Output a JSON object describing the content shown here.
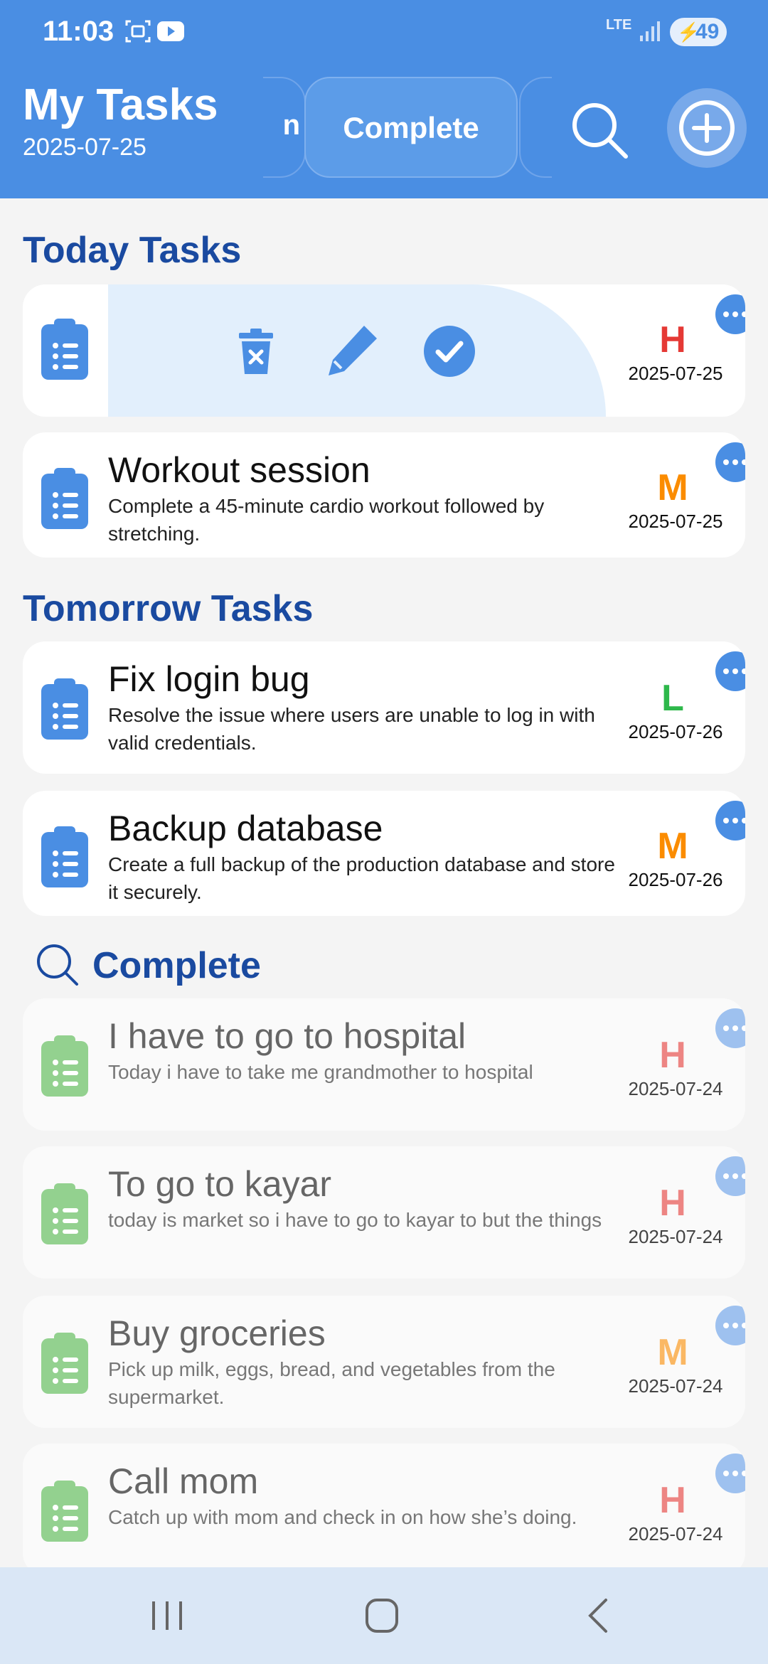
{
  "status_bar": {
    "time": "11:03",
    "network": "LTE",
    "battery": "49"
  },
  "header": {
    "title": "My Tasks",
    "date": "2025-07-25",
    "tabs": {
      "active": "Complete",
      "previous_partial": "n"
    }
  },
  "sections": {
    "today": "Today Tasks",
    "tomorrow": "Tomorrow Tasks",
    "complete": "Complete"
  },
  "today_tasks": [
    {
      "title": "",
      "description": "",
      "priority": "H",
      "date": "2025-07-25",
      "swipe_actions": [
        "delete",
        "edit",
        "complete"
      ]
    },
    {
      "title": "Workout session",
      "description": "Complete a 45-minute cardio workout followed by stretching.",
      "priority": "M",
      "date": "2025-07-25"
    }
  ],
  "tomorrow_tasks": [
    {
      "title": "Fix login bug",
      "description": "Resolve the issue where users are unable to log in with valid credentials.",
      "priority": "L",
      "date": "2025-07-26"
    },
    {
      "title": "Backup database",
      "description": "Create a full backup of the production database and store it securely.",
      "priority": "M",
      "date": "2025-07-26"
    }
  ],
  "complete_tasks": [
    {
      "title": "I have to go to hospital",
      "description": "Today i have to take me grandmother to hospital",
      "priority": "H",
      "date": "2025-07-24"
    },
    {
      "title": "To go to kayar",
      "description": "today is market so i have to go to kayar to but the things",
      "priority": "H",
      "date": "2025-07-24"
    },
    {
      "title": "Buy groceries",
      "description": "Pick up milk, eggs, bread, and vegetables from the supermarket.",
      "priority": "M",
      "date": "2025-07-24"
    },
    {
      "title": "Call mom",
      "description": "Catch up with mom and check in on how she’s doing.",
      "priority": "H",
      "date": "2025-07-24"
    }
  ],
  "colors": {
    "accent": "#4a8ee3",
    "section_title": "#1a4aa0",
    "priority_high": "#e53935",
    "priority_medium": "#fb8c00",
    "priority_low": "#2eb84b",
    "icon_active": "#4a8ee3",
    "icon_done": "#93d18f"
  },
  "icons": [
    "search-icon",
    "plus-circle-icon",
    "clipboard-list-icon",
    "more-horizontal-icon",
    "trash-icon",
    "pencil-icon",
    "check-circle-icon",
    "recents-icon",
    "home-icon",
    "back-icon"
  ]
}
